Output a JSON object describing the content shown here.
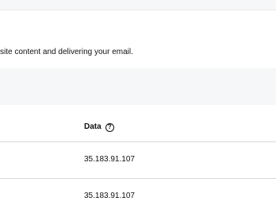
{
  "description": {
    "text": "site content and delivering your email."
  },
  "table": {
    "columns": [
      {
        "label": "Data",
        "help_icon": "question-circle-icon"
      }
    ],
    "rows": [
      {
        "data": "35.183.91.107"
      },
      {
        "data": "35.183.91.107"
      }
    ]
  }
}
